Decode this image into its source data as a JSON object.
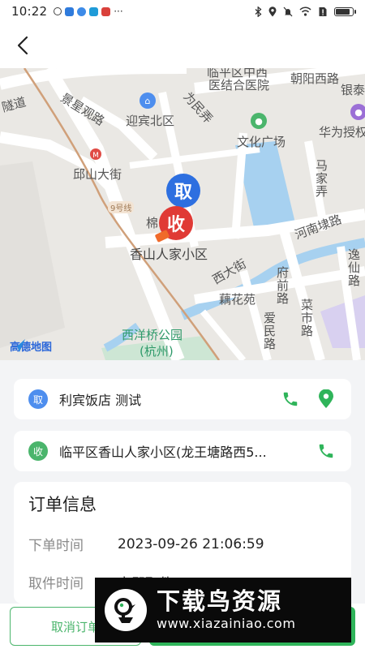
{
  "status_bar": {
    "time": "10:22",
    "more": "···",
    "battery_level": 0.85
  },
  "header": {
    "back_icon": "chevron-left-icon"
  },
  "map": {
    "labels": {
      "hospital_1": "临平区中西",
      "hospital_2": "医结合医院",
      "road_chaoyang": "朝阳西路",
      "bank": "银泰",
      "road_suidao": "隧道",
      "road_jingxingguan": "景星观路",
      "yingbin_district": "迎宾北区",
      "road_weiminnong": "为民弄",
      "culture_square": "文化广场",
      "huawei": "华为授权",
      "qiushan_street": "邱山大街",
      "majianong": "马家弄",
      "line9": "9号线",
      "road_henan": "河南埭路",
      "partial_label": "棉",
      "xiangshan": "香山人家小区",
      "road_xida": "西大街",
      "road_fuqian": "府前路",
      "road_yixian": "逸仙路",
      "ouhuayuan": "藕花苑",
      "road_caishi": "菜市路",
      "road_aimin": "爱民路",
      "park_1": "西洋桥公园",
      "park_2": "(杭州)",
      "logo_text": "高德地图"
    },
    "pickup_marker": "取",
    "delivery_marker": "收"
  },
  "pickup": {
    "badge": "取",
    "address": "利宾饭店 测试"
  },
  "delivery": {
    "badge": "收",
    "address": "临平区香山人家小区(龙王塘路西5..."
  },
  "order": {
    "title": "订单信息",
    "rows": [
      {
        "label": "下单时间",
        "value": "2023-09-26 21:06:59"
      },
      {
        "label": "取件时间",
        "value": "立即取件"
      }
    ]
  },
  "buttons": {
    "cancel": "取消订单"
  },
  "watermark": {
    "title": "下载鸟资源",
    "url": "www.xiazainiao.com"
  },
  "colors": {
    "pickup_blue": "#2d6fe0",
    "delivery_red": "#e03a35",
    "accent_green": "#2fb45a"
  }
}
